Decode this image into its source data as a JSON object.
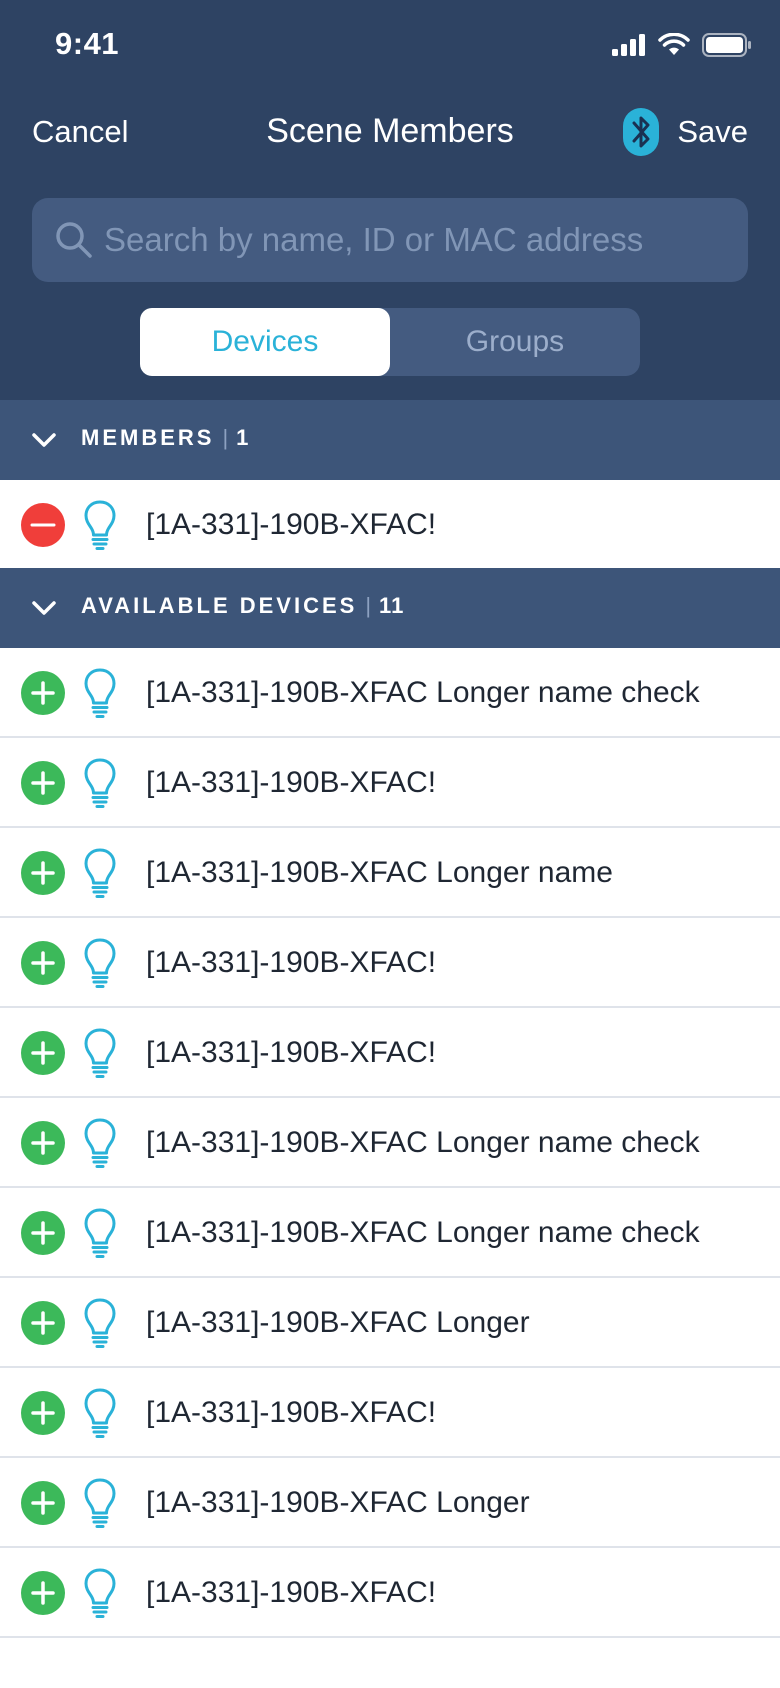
{
  "status_bar": {
    "time": "9:41"
  },
  "nav": {
    "cancel_label": "Cancel",
    "title": "Scene Members",
    "save_label": "Save"
  },
  "search": {
    "placeholder": "Search by name, ID or MAC address",
    "value": ""
  },
  "tabs": {
    "devices_label": "Devices",
    "groups_label": "Groups",
    "selected": "Devices"
  },
  "members": {
    "header_label": "MEMBERS",
    "count": "1",
    "items": [
      {
        "name": "[1A-331]-190B-XFAC!"
      }
    ]
  },
  "available": {
    "header_label": "AVAILABLE DEVICES",
    "count": "11",
    "items": [
      {
        "name": "[1A-331]-190B-XFAC Longer name check"
      },
      {
        "name": "[1A-331]-190B-XFAC!"
      },
      {
        "name": "[1A-331]-190B-XFAC Longer name"
      },
      {
        "name": "[1A-331]-190B-XFAC!"
      },
      {
        "name": "[1A-331]-190B-XFAC!"
      },
      {
        "name": "[1A-331]-190B-XFAC Longer name check"
      },
      {
        "name": "[1A-331]-190B-XFAC Longer name check"
      },
      {
        "name": "[1A-331]-190B-XFAC Longer"
      },
      {
        "name": "[1A-331]-190B-XFAC!"
      },
      {
        "name": "[1A-331]-190B-XFAC Longer"
      },
      {
        "name": "[1A-331]-190B-XFAC!"
      }
    ]
  },
  "colors": {
    "header_bg": "#2e4363",
    "section_bg": "#3d5579",
    "accent": "#2ab2d8",
    "add_green": "#3cb95a",
    "remove_red": "#f03e3a"
  },
  "icons": [
    "signal-icon",
    "wifi-icon",
    "battery-icon",
    "bluetooth-icon",
    "search-icon",
    "chevron-down-icon",
    "add-icon",
    "remove-icon",
    "bulb-icon"
  ]
}
